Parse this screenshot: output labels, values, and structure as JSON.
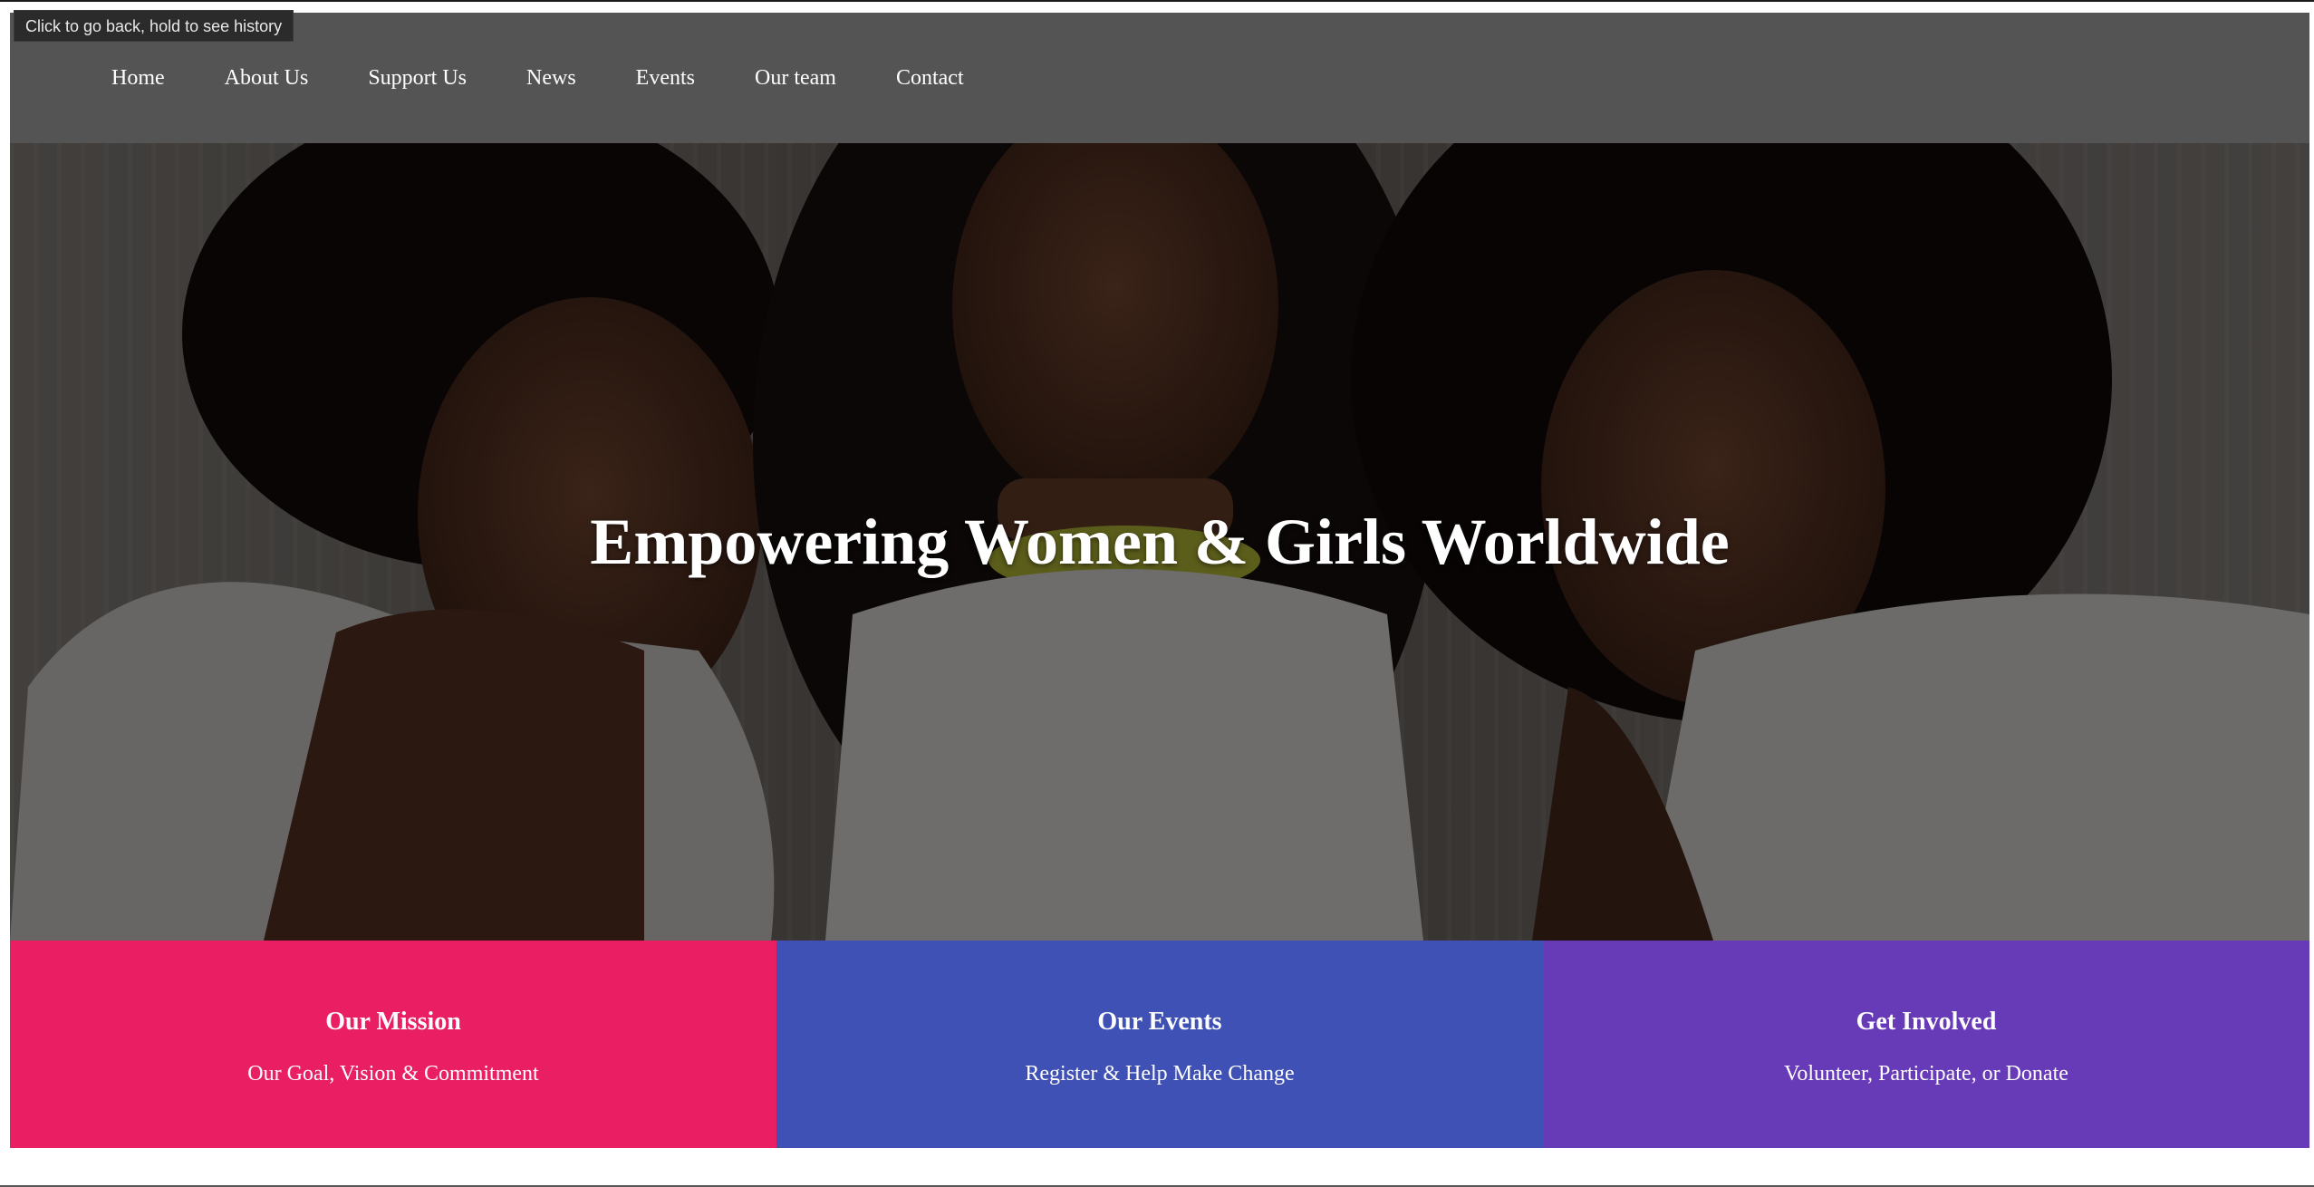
{
  "browser": {
    "back_tooltip": "Click to go back, hold to see history"
  },
  "nav": {
    "items": [
      {
        "label": "Home"
      },
      {
        "label": "About Us"
      },
      {
        "label": "Support Us"
      },
      {
        "label": "News"
      },
      {
        "label": "Events"
      },
      {
        "label": "Our team"
      },
      {
        "label": "Contact"
      }
    ]
  },
  "hero": {
    "title": "Empowering Women & Girls Worldwide"
  },
  "cards": [
    {
      "title": "Our Mission",
      "subtitle": "Our Goal, Vision & Commitment",
      "color": "#e91e63"
    },
    {
      "title": "Our Events",
      "subtitle": "Register & Help Make Change",
      "color": "#3f51b5"
    },
    {
      "title": "Get Involved",
      "subtitle": "Volunteer, Participate, or Donate",
      "color": "#673ab7"
    }
  ],
  "colors": {
    "navbar_bg": "#545454",
    "tooltip_bg": "#2b2b2b"
  }
}
